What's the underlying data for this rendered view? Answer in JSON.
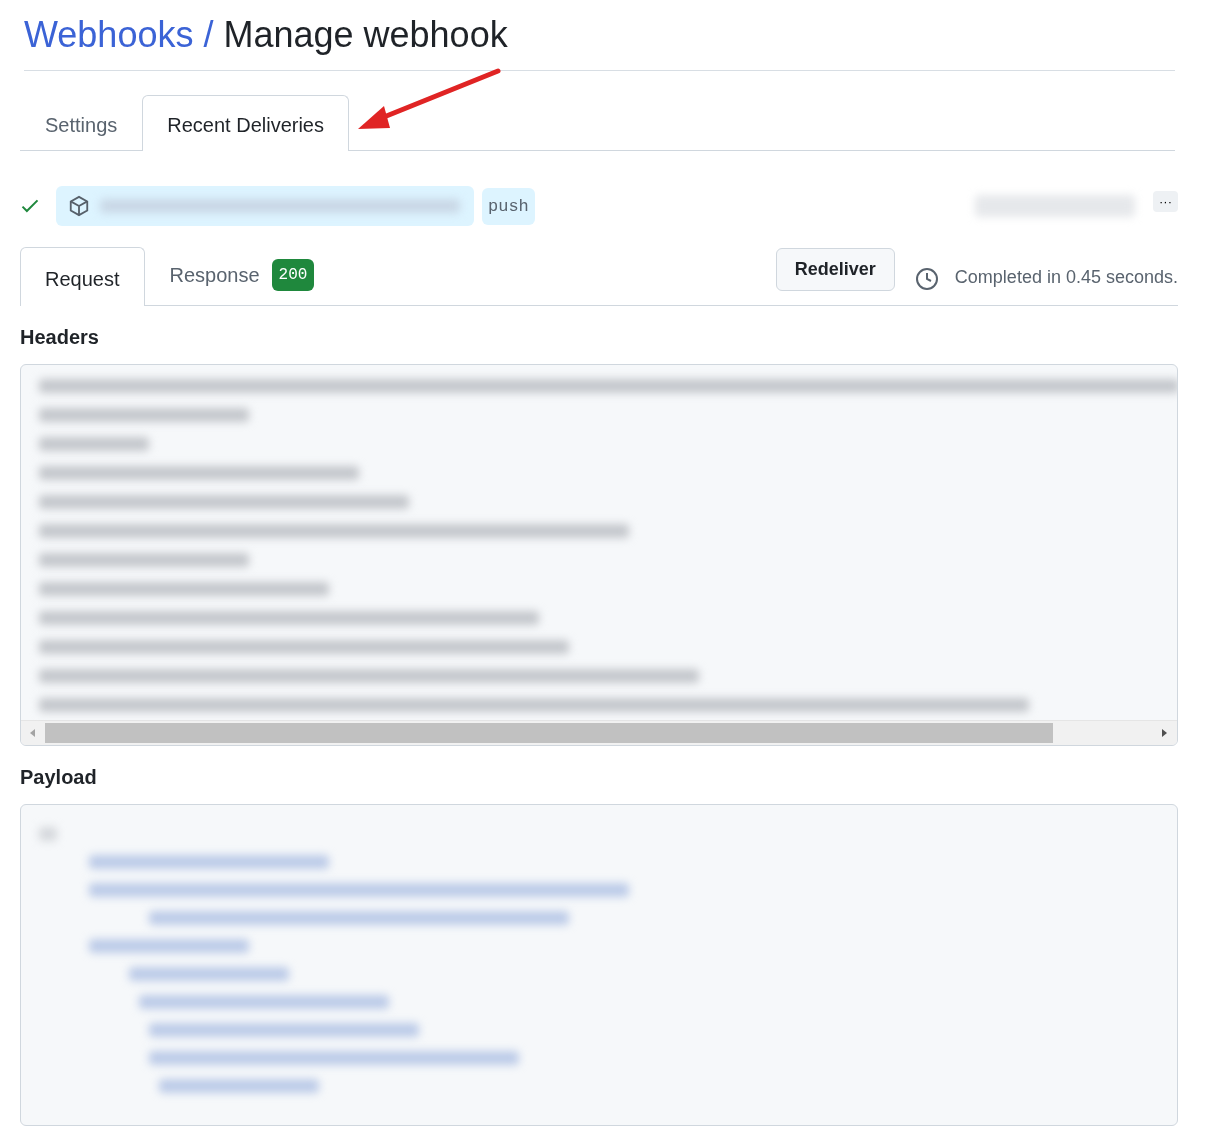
{
  "breadcrumb": {
    "parent": "Webhooks",
    "separator": "/",
    "current": "Manage webhook"
  },
  "tabs": [
    {
      "label": "Settings",
      "selected": false
    },
    {
      "label": "Recent Deliveries",
      "selected": true
    }
  ],
  "delivery": {
    "success": true,
    "event": "push",
    "menu": "···"
  },
  "detail_tabs": [
    {
      "label": "Request",
      "selected": true
    },
    {
      "label": "Response",
      "selected": false,
      "badge": "200"
    }
  ],
  "redeliver_button": "Redeliver",
  "duration": "Completed in 0.45 seconds.",
  "sections": [
    {
      "title": "Headers",
      "kind": "scroll"
    },
    {
      "title": "Payload",
      "kind": "plain"
    }
  ]
}
